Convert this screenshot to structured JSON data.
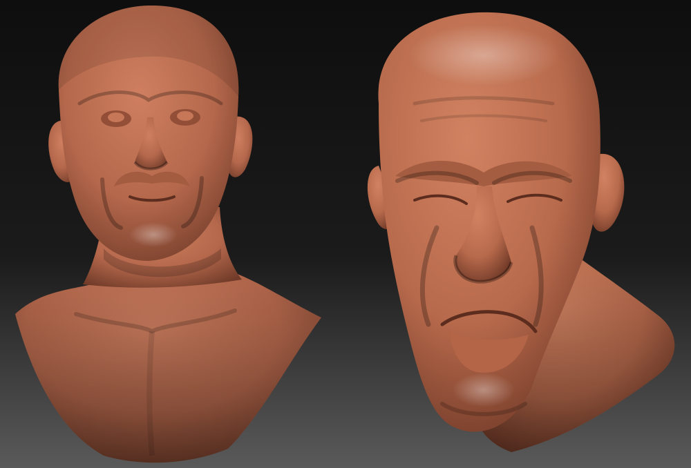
{
  "scene": {
    "subjects": [
      {
        "id": "bust-left",
        "material_color": "#b5684c"
      },
      {
        "id": "head-right",
        "material_color": "#b86a4c"
      }
    ],
    "background": {
      "top_color": "#0e0e0e",
      "bottom_color": "#5a5a5a"
    }
  }
}
